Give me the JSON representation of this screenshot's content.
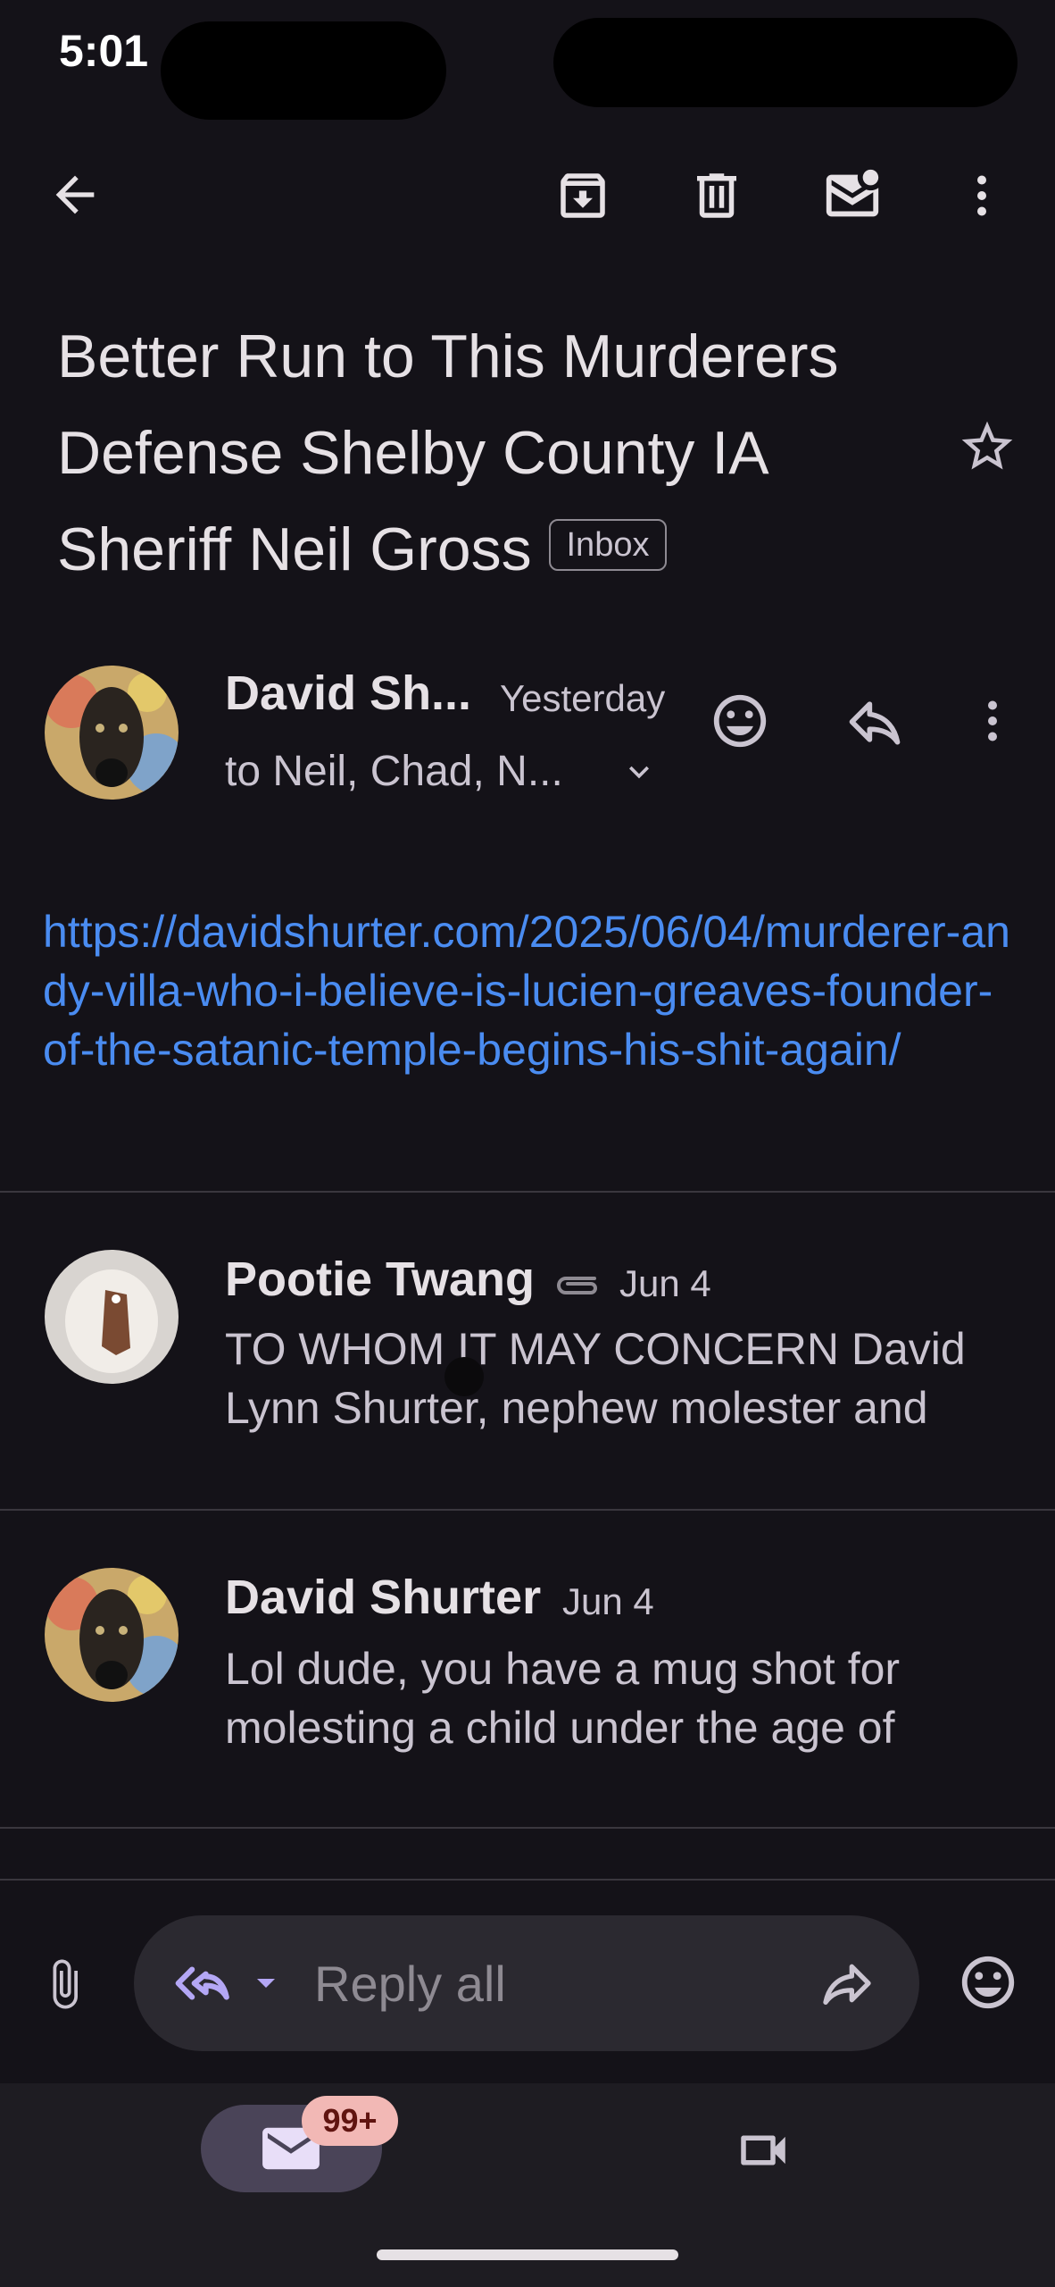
{
  "status": {
    "time": "5:01"
  },
  "toolbar": {
    "back_icon": "arrow-left-icon",
    "archive_icon": "archive-icon",
    "delete_icon": "trash-icon",
    "mark_unread_icon": "mail-unread-icon",
    "more_icon": "more-vertical-icon"
  },
  "email": {
    "subject": "Better Run to This Murderers Defense Shelby County IA Sheriff Neil Gross",
    "label": "Inbox"
  },
  "message": {
    "sender": "David Sh...",
    "date": "Yesterday",
    "recipients": "to Neil, Chad, N...",
    "body_link": "https://davidshurter.com/2025/06/04/murderer-andy-villa-who-i-believe-is-lucien-greaves-founder-of-the-satanic-temple-begins-his-shit-again/"
  },
  "thread": [
    {
      "sender": "Pootie Twang",
      "date": "Jun 4",
      "has_attachment": true,
      "snippet_line1": "TO WHOM IT MAY CONCERN David",
      "snippet_line2": "Lynn Shurter, nephew molester and"
    },
    {
      "sender": "David Shurter",
      "date": "Jun 4",
      "has_attachment": false,
      "snippet_line1": "Lol dude, you have a mug shot for",
      "snippet_line2": "molesting a child under the age of"
    }
  ],
  "reply_bar": {
    "label": "Reply all"
  },
  "nav": {
    "mail_badge": "99+"
  },
  "colors": {
    "background": "#141218",
    "link": "#4a8cf1",
    "badge": "#f2b8b5"
  }
}
